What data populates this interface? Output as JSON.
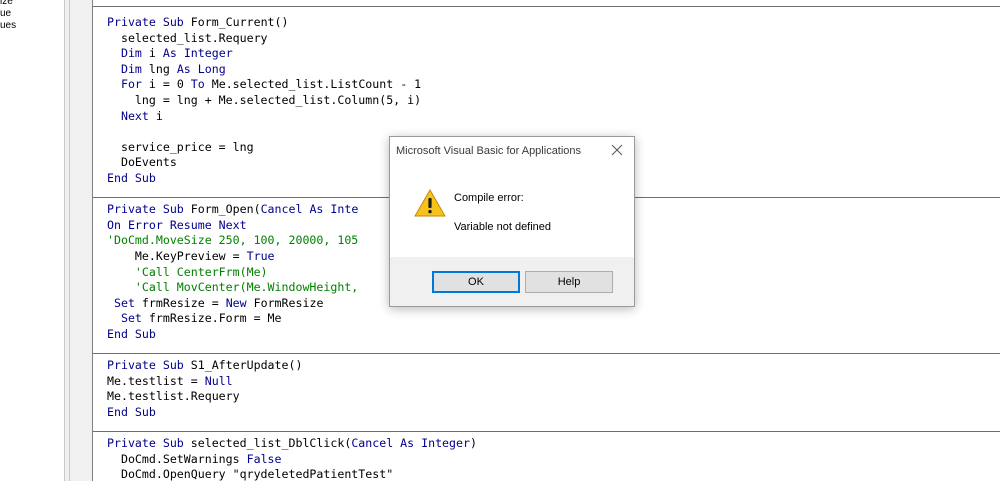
{
  "left_pane": {
    "items": [
      "ize",
      "ue",
      "ues"
    ]
  },
  "code": {
    "lines": [
      [
        {
          "t": "Private Sub ",
          "c": "kw"
        },
        {
          "t": "Form_Current()"
        }
      ],
      [
        {
          "t": "  selected_list.Requery"
        }
      ],
      [
        {
          "t": "  "
        },
        {
          "t": "Dim",
          "c": "kw"
        },
        {
          "t": " i "
        },
        {
          "t": "As Integer",
          "c": "kw"
        }
      ],
      [
        {
          "t": "  "
        },
        {
          "t": "Dim",
          "c": "kw"
        },
        {
          "t": " lng "
        },
        {
          "t": "As Long",
          "c": "kw"
        }
      ],
      [
        {
          "t": "  "
        },
        {
          "t": "For",
          "c": "kw"
        },
        {
          "t": " i = 0 "
        },
        {
          "t": "To",
          "c": "kw"
        },
        {
          "t": " Me.selected_list.ListCount - 1"
        }
      ],
      [
        {
          "t": "    lng = lng + Me.selected_list.Column(5, i)"
        }
      ],
      [
        {
          "t": "  "
        },
        {
          "t": "Next",
          "c": "kw"
        },
        {
          "t": " i"
        }
      ],
      [],
      [
        {
          "t": "  service_price = lng"
        }
      ],
      [
        {
          "t": "  DoEvents"
        }
      ],
      [
        {
          "t": "End Sub",
          "c": "kw"
        }
      ],
      [],
      [
        {
          "t": "Private Sub ",
          "c": "kw"
        },
        {
          "t": "Form_Open("
        },
        {
          "t": "Cancel As Inte",
          "c": "kw"
        }
      ],
      [
        {
          "t": "On Error Resume Next",
          "c": "kw"
        }
      ],
      [
        {
          "t": "'DoCmd.MoveSize 250, 100, 20000, 105",
          "c": "cm"
        }
      ],
      [
        {
          "t": "    Me.KeyPreview = "
        },
        {
          "t": "True",
          "c": "kw"
        }
      ],
      [
        {
          "t": "    'Call CenterFrm(Me)",
          "c": "cm"
        }
      ],
      [
        {
          "t": "    'Call MovCenter(Me.WindowHeight,",
          "c": "cm"
        }
      ],
      [
        {
          "t": " "
        },
        {
          "t": "Set",
          "c": "kw"
        },
        {
          "t": " frmResize = "
        },
        {
          "t": "New",
          "c": "kw"
        },
        {
          "t": " FormResize"
        }
      ],
      [
        {
          "t": "  "
        },
        {
          "t": "Set",
          "c": "kw"
        },
        {
          "t": " frmResize.Form = Me"
        }
      ],
      [
        {
          "t": "End Sub",
          "c": "kw"
        }
      ],
      [],
      [
        {
          "t": "Private Sub ",
          "c": "kw"
        },
        {
          "t": "S1_AfterUpdate()"
        }
      ],
      [
        {
          "t": "Me.testlist = "
        },
        {
          "t": "Null",
          "c": "kw"
        }
      ],
      [
        {
          "t": "Me.testlist.Requery"
        }
      ],
      [
        {
          "t": "End Sub",
          "c": "kw"
        }
      ],
      [],
      [
        {
          "t": "Private Sub ",
          "c": "kw"
        },
        {
          "t": "selected_list_DblClick("
        },
        {
          "t": "Cancel As Integer",
          "c": "kw"
        },
        {
          "t": ")"
        }
      ],
      [
        {
          "t": "  DoCmd.SetWarnings "
        },
        {
          "t": "False",
          "c": "kw"
        }
      ],
      [
        {
          "t": "  DoCmd.OpenQuery \"qrydeletedPatientTest\""
        }
      ]
    ]
  },
  "dialog": {
    "title": "Microsoft Visual Basic for Applications",
    "message_heading": "Compile error:",
    "message_detail": "Variable not defined",
    "ok_label": "OK",
    "help_label": "Help",
    "icon": "warning-icon",
    "close_icon": "close-icon"
  },
  "colors": {
    "keyword": "#00008b",
    "comment": "#008000",
    "dialog_accent": "#0078d7"
  }
}
